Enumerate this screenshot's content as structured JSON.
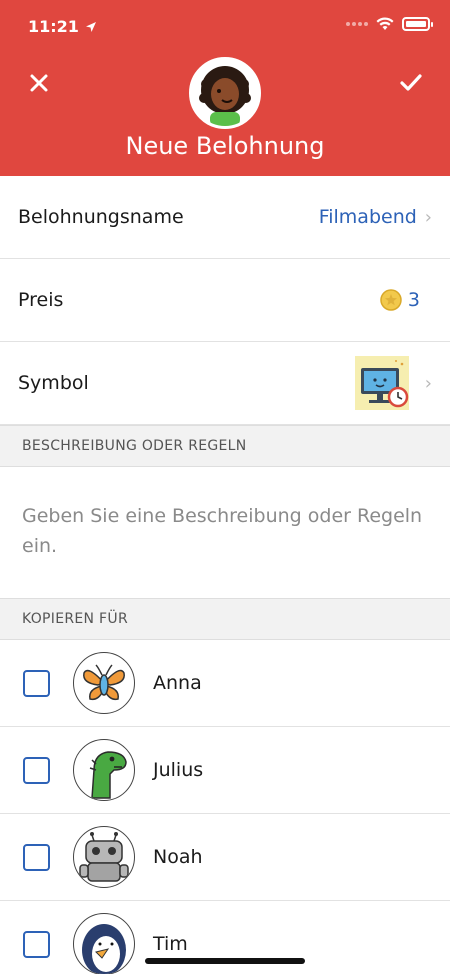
{
  "status_bar": {
    "time": "11:21"
  },
  "header": {
    "title": "Neue Belohnung",
    "close_icon": "close-icon",
    "confirm_icon": "checkmark-icon",
    "color": "#e0473f"
  },
  "form": {
    "name": {
      "label": "Belohnungsname",
      "value": "Filmabend"
    },
    "price": {
      "label": "Preis",
      "value": "3"
    },
    "symbol": {
      "label": "Symbol"
    }
  },
  "description_section": {
    "header": "BESCHREIBUNG ODER REGELN",
    "placeholder": "Geben Sie eine Beschreibung oder Regeln ein."
  },
  "copy_section": {
    "header": "KOPIEREN FÜR",
    "people": [
      {
        "name": "Anna",
        "avatar": "butterfly-avatar"
      },
      {
        "name": "Julius",
        "avatar": "dinosaur-avatar"
      },
      {
        "name": "Noah",
        "avatar": "robot-avatar"
      },
      {
        "name": "Tim",
        "avatar": "penguin-avatar"
      }
    ]
  },
  "colors": {
    "accent": "#2d62b7",
    "header": "#e0473f"
  }
}
